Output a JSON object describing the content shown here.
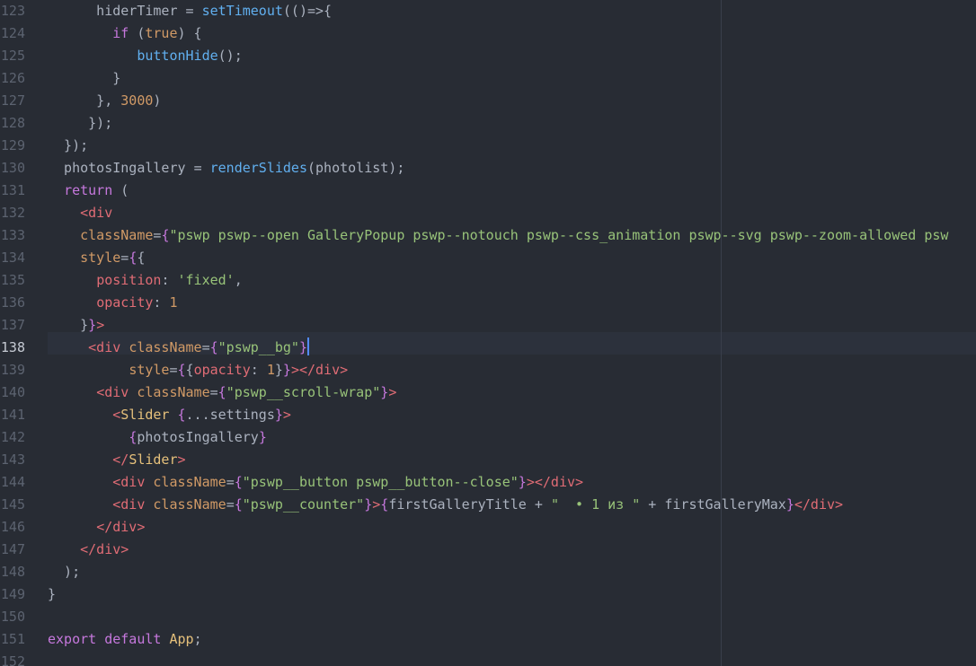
{
  "editor": {
    "theme_colors": {
      "background": "#282c34",
      "keyword": "#c678dd",
      "function": "#61afef",
      "number": "#d19a66",
      "string": "#98c379",
      "tag": "#e06c75",
      "component": "#e5c07b",
      "cursor": "#528bff"
    },
    "active_line": "138",
    "lines": [
      {
        "n": "123",
        "t": [
          [
            "plain",
            "      hiderTimer "
          ],
          [
            "pun",
            "= "
          ],
          [
            "fn",
            "setTimeout"
          ],
          [
            "pun",
            "(()=>{"
          ]
        ]
      },
      {
        "n": "124",
        "t": [
          [
            "plain",
            "        "
          ],
          [
            "kw",
            "if"
          ],
          [
            "pun",
            " ("
          ],
          [
            "num",
            "true"
          ],
          [
            "pun",
            ") {"
          ]
        ]
      },
      {
        "n": "125",
        "t": [
          [
            "plain",
            "           "
          ],
          [
            "fn",
            "buttonHide"
          ],
          [
            "pun",
            "();"
          ]
        ]
      },
      {
        "n": "126",
        "t": [
          [
            "pun",
            "        }"
          ]
        ]
      },
      {
        "n": "127",
        "t": [
          [
            "pun",
            "      }, "
          ],
          [
            "num",
            "3000"
          ],
          [
            "pun",
            ")"
          ]
        ]
      },
      {
        "n": "128",
        "t": [
          [
            "pun",
            "     });"
          ]
        ]
      },
      {
        "n": "129",
        "t": [
          [
            "pun",
            "  });"
          ]
        ]
      },
      {
        "n": "130",
        "t": [
          [
            "plain",
            "  photosIngallery "
          ],
          [
            "pun",
            "= "
          ],
          [
            "fn",
            "renderSlides"
          ],
          [
            "pun",
            "(photolist);"
          ]
        ]
      },
      {
        "n": "131",
        "t": [
          [
            "plain",
            "  "
          ],
          [
            "kw",
            "return"
          ],
          [
            "pun",
            " ("
          ]
        ]
      },
      {
        "n": "132",
        "t": [
          [
            "plain",
            "    "
          ],
          [
            "tag",
            "<div"
          ]
        ]
      },
      {
        "n": "133",
        "t": [
          [
            "plain",
            "    "
          ],
          [
            "attr",
            "className"
          ],
          [
            "pun",
            "="
          ],
          [
            "brace",
            "{"
          ],
          [
            "str",
            "\"pswp pswp--open GalleryPopup pswp--notouch pswp--css_animation pswp--svg pswp--zoom-allowed psw"
          ]
        ]
      },
      {
        "n": "134",
        "t": [
          [
            "plain",
            "    "
          ],
          [
            "attr",
            "style"
          ],
          [
            "pun",
            "="
          ],
          [
            "brace",
            "{"
          ],
          [
            "pun",
            "{"
          ]
        ]
      },
      {
        "n": "135",
        "t": [
          [
            "plain",
            "      "
          ],
          [
            "prop",
            "position"
          ],
          [
            "pun",
            ": "
          ],
          [
            "str",
            "'fixed'"
          ],
          [
            "pun",
            ","
          ]
        ]
      },
      {
        "n": "136",
        "t": [
          [
            "plain",
            "      "
          ],
          [
            "prop",
            "opacity"
          ],
          [
            "pun",
            ": "
          ],
          [
            "num",
            "1"
          ]
        ]
      },
      {
        "n": "137",
        "t": [
          [
            "pun",
            "    }"
          ],
          [
            "brace",
            "}"
          ],
          [
            "tag",
            ">"
          ]
        ]
      },
      {
        "n": "138",
        "t": [
          [
            "plain",
            "     "
          ],
          [
            "tag",
            "<div "
          ],
          [
            "attr",
            "className"
          ],
          [
            "pun",
            "="
          ],
          [
            "brace",
            "{"
          ],
          [
            "str",
            "\"pswp__bg\""
          ],
          [
            "brace",
            "}"
          ]
        ],
        "cursor": true
      },
      {
        "n": "139",
        "t": [
          [
            "plain",
            "          "
          ],
          [
            "attr",
            "style"
          ],
          [
            "pun",
            "="
          ],
          [
            "brace",
            "{"
          ],
          [
            "pun",
            "{"
          ],
          [
            "prop",
            "opacity"
          ],
          [
            "pun",
            ": "
          ],
          [
            "num",
            "1"
          ],
          [
            "pun",
            "}"
          ],
          [
            "brace",
            "}"
          ],
          [
            "tag",
            "></div>"
          ]
        ]
      },
      {
        "n": "140",
        "t": [
          [
            "plain",
            "      "
          ],
          [
            "tag",
            "<div "
          ],
          [
            "attr",
            "className"
          ],
          [
            "pun",
            "="
          ],
          [
            "brace",
            "{"
          ],
          [
            "str",
            "\"pswp__scroll-wrap\""
          ],
          [
            "brace",
            "}"
          ],
          [
            "tag",
            ">"
          ]
        ]
      },
      {
        "n": "141",
        "t": [
          [
            "plain",
            "        "
          ],
          [
            "tag",
            "<"
          ],
          [
            "comp",
            "Slider"
          ],
          [
            "plain",
            " "
          ],
          [
            "brace",
            "{"
          ],
          [
            "pun",
            "...settings"
          ],
          [
            "brace",
            "}"
          ],
          [
            "tag",
            ">"
          ]
        ]
      },
      {
        "n": "142",
        "t": [
          [
            "plain",
            "          "
          ],
          [
            "brace",
            "{"
          ],
          [
            "plain",
            "photosIngallery"
          ],
          [
            "brace",
            "}"
          ]
        ]
      },
      {
        "n": "143",
        "t": [
          [
            "plain",
            "        "
          ],
          [
            "tag",
            "</"
          ],
          [
            "comp",
            "Slider"
          ],
          [
            "tag",
            ">"
          ]
        ]
      },
      {
        "n": "144",
        "t": [
          [
            "plain",
            "        "
          ],
          [
            "tag",
            "<div "
          ],
          [
            "attr",
            "className"
          ],
          [
            "pun",
            "="
          ],
          [
            "brace",
            "{"
          ],
          [
            "str",
            "\"pswp__button pswp__button--close\""
          ],
          [
            "brace",
            "}"
          ],
          [
            "tag",
            "></div>"
          ]
        ]
      },
      {
        "n": "145",
        "t": [
          [
            "plain",
            "        "
          ],
          [
            "tag",
            "<div "
          ],
          [
            "attr",
            "className"
          ],
          [
            "pun",
            "="
          ],
          [
            "brace",
            "{"
          ],
          [
            "str",
            "\"pswp__counter\""
          ],
          [
            "brace",
            "}"
          ],
          [
            "tag",
            ">"
          ],
          [
            "brace",
            "{"
          ],
          [
            "plain",
            "firstGalleryTitle + "
          ],
          [
            "str",
            "\"  • 1 из \""
          ],
          [
            "plain",
            " + firstGalleryMax"
          ],
          [
            "brace",
            "}"
          ],
          [
            "tag",
            "</div>"
          ]
        ]
      },
      {
        "n": "146",
        "t": [
          [
            "plain",
            "      "
          ],
          [
            "tag",
            "</div>"
          ]
        ]
      },
      {
        "n": "147",
        "t": [
          [
            "plain",
            "    "
          ],
          [
            "tag",
            "</div>"
          ]
        ]
      },
      {
        "n": "148",
        "t": [
          [
            "pun",
            "  );"
          ]
        ]
      },
      {
        "n": "149",
        "t": [
          [
            "pun",
            "}"
          ]
        ]
      },
      {
        "n": "150",
        "t": []
      },
      {
        "n": "151",
        "t": [
          [
            "kw",
            "export"
          ],
          [
            "plain",
            " "
          ],
          [
            "kw",
            "default"
          ],
          [
            "plain",
            " "
          ],
          [
            "comp",
            "App"
          ],
          [
            "pun",
            ";"
          ]
        ]
      },
      {
        "n": "152",
        "t": []
      }
    ]
  }
}
